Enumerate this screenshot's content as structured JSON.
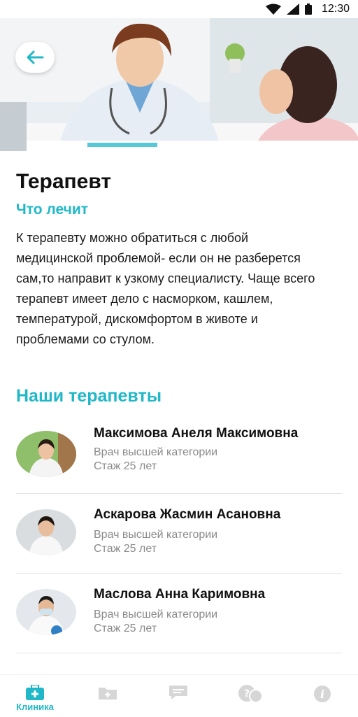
{
  "status_bar": {
    "time": "12:30"
  },
  "page": {
    "title": "Терапевт",
    "subtitle": "Что лечит",
    "description": "К терапевту можно обратиться с любой медицинской проблемой- если он не разберется сам,то направит к узкому специалисту. Чаще всего терапевт имеет дело с насморком, кашлем, температурой, дискомфортом в животе и проблемами со стулом.",
    "section_title": "Наши терапевты"
  },
  "doctors": [
    {
      "name": "Максимова Анеля Максимовна",
      "category": "Врач высшей категории",
      "experience": "Стаж 25 лет"
    },
    {
      "name": "Аскарова Жасмин Асановна",
      "category": "Врач высшей категории",
      "experience": "Стаж 25 лет"
    },
    {
      "name": "Маслова Анна Каримовна",
      "category": "Врач высшей категории",
      "experience": "Стаж 25 лет"
    }
  ],
  "tabbar": {
    "active_label": "Клиника",
    "tabs": [
      "clinic-icon",
      "medical-folder-icon",
      "chat-icon",
      "faq-icon",
      "info-icon"
    ]
  },
  "colors": {
    "accent": "#20b8c8",
    "inactive": "#d6d6d6"
  }
}
